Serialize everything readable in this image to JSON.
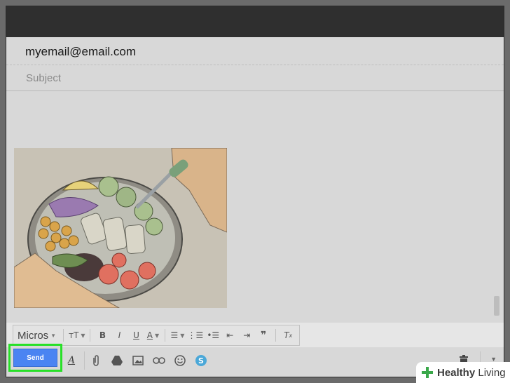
{
  "compose": {
    "to_value": "myemail@email.com",
    "subject_placeholder": "Subject"
  },
  "image": {
    "description": "salad bowl illustration",
    "background": "#c9c3b6"
  },
  "format_toolbar": {
    "font": "Micros",
    "items": [
      "font-size",
      "bold",
      "italic",
      "underline",
      "text-color",
      "align",
      "numbered-list",
      "bulleted-list",
      "indent-less",
      "indent-more",
      "quote",
      "remove-formatting"
    ]
  },
  "bottom_bar": {
    "send_label": "Send",
    "icons": [
      "formatting-icon",
      "attach-icon",
      "drive-icon",
      "photo-icon",
      "link-icon",
      "emoji-icon",
      "skype-icon",
      "trash-icon",
      "more-options-icon"
    ]
  },
  "watermark": {
    "brand_bold": "Healthy",
    "brand_light": "Living"
  },
  "colors": {
    "send_blue": "#4a84f2",
    "highlight_green": "#28e028",
    "watermark_green": "#3aa84a"
  }
}
